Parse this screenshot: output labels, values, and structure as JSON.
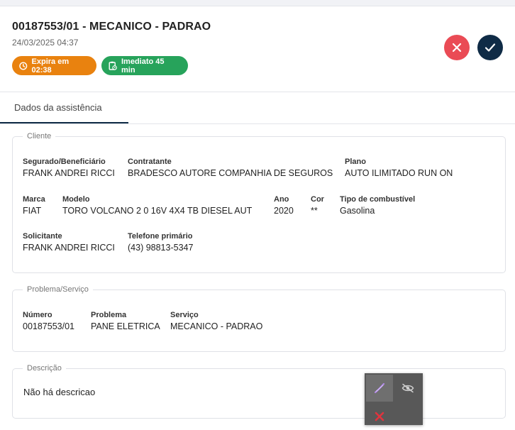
{
  "header": {
    "title": "00187553/01 - MECANICO - PADRAO",
    "date": "24/03/2025 04:37",
    "chip_expira": "Expira em 02:38",
    "chip_imediato": "Imediato 45 min",
    "colors": {
      "expira": "#e9820f",
      "imediato": "#27a35b",
      "reject": "#ea4b55",
      "accept": "#0f2b46"
    }
  },
  "tabs": [
    {
      "label": "Dados da assistência",
      "active": true
    }
  ],
  "cliente": {
    "legend": "Cliente",
    "segurado_label": "Segurado/Beneficiário",
    "segurado_value": "FRANK ANDREI RICCI",
    "contratante_label": "Contratante",
    "contratante_value": "BRADESCO AUTORE COMPANHIA DE SEGUROS",
    "plano_label": "Plano",
    "plano_value": "AUTO ILIMITADO RUN ON",
    "marca_label": "Marca",
    "marca_value": "FIAT",
    "modelo_label": "Modelo",
    "modelo_value": "TORO VOLCANO 2 0 16V 4X4 TB DIESEL AUT",
    "ano_label": "Ano",
    "ano_value": "2020",
    "cor_label": "Cor",
    "cor_value": "**",
    "combustivel_label": "Tipo de combustível",
    "combustivel_value": "Gasolina",
    "solicitante_label": "Solicitante",
    "solicitante_value": "FRANK ANDREI RICCI",
    "telefone_label": "Telefone primário",
    "telefone_value": "(43) 98813-5347"
  },
  "problema": {
    "legend": "Problema/Serviço",
    "numero_label": "Número",
    "numero_value": "00187553/01",
    "problema_label": "Problema",
    "problema_value": "PANE ELETRICA",
    "servico_label": "Serviço",
    "servico_value": "MECANICO - PADRAO"
  },
  "descricao": {
    "legend": "Descrição",
    "text": "Não há descricao"
  },
  "toolbar": {
    "icons": [
      "pen-icon",
      "eye-off-icon",
      "close-icon"
    ]
  }
}
